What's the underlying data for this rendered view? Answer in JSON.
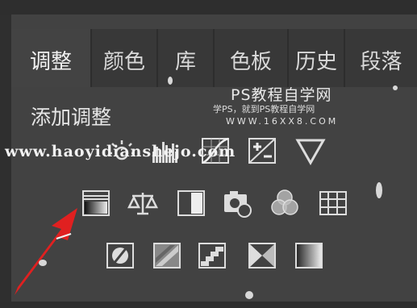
{
  "tabs": [
    {
      "label": "调整",
      "active": true
    },
    {
      "label": "颜色"
    },
    {
      "label": "库"
    },
    {
      "label": "色板"
    },
    {
      "label": "历史"
    },
    {
      "label": "段落"
    }
  ],
  "panel": {
    "title": "添加调整"
  },
  "watermark": {
    "site_cn": "PS教程自学网",
    "site_sub": "学PS，就到PS教程自学网",
    "site_url": "WWW.16XX8.COM",
    "overlay_url": "www.haoyidianshejo.com"
  },
  "icons": {
    "row1": [
      "brightness-contrast-icon",
      "levels-icon",
      "curves-icon",
      "exposure-icon",
      "vibrance-icon"
    ],
    "row2": [
      "gradient-map-icon",
      "color-balance-icon",
      "black-white-icon",
      "photo-filter-icon",
      "channel-mixer-icon",
      "color-lookup-icon"
    ],
    "row3": [
      "invert-icon",
      "posterize-icon",
      "threshold-icon",
      "selective-color-icon",
      "gradient-icon"
    ]
  },
  "colors": {
    "panel_bg": "#424242",
    "tab_bg": "#383838",
    "arrow": "#e02020"
  }
}
